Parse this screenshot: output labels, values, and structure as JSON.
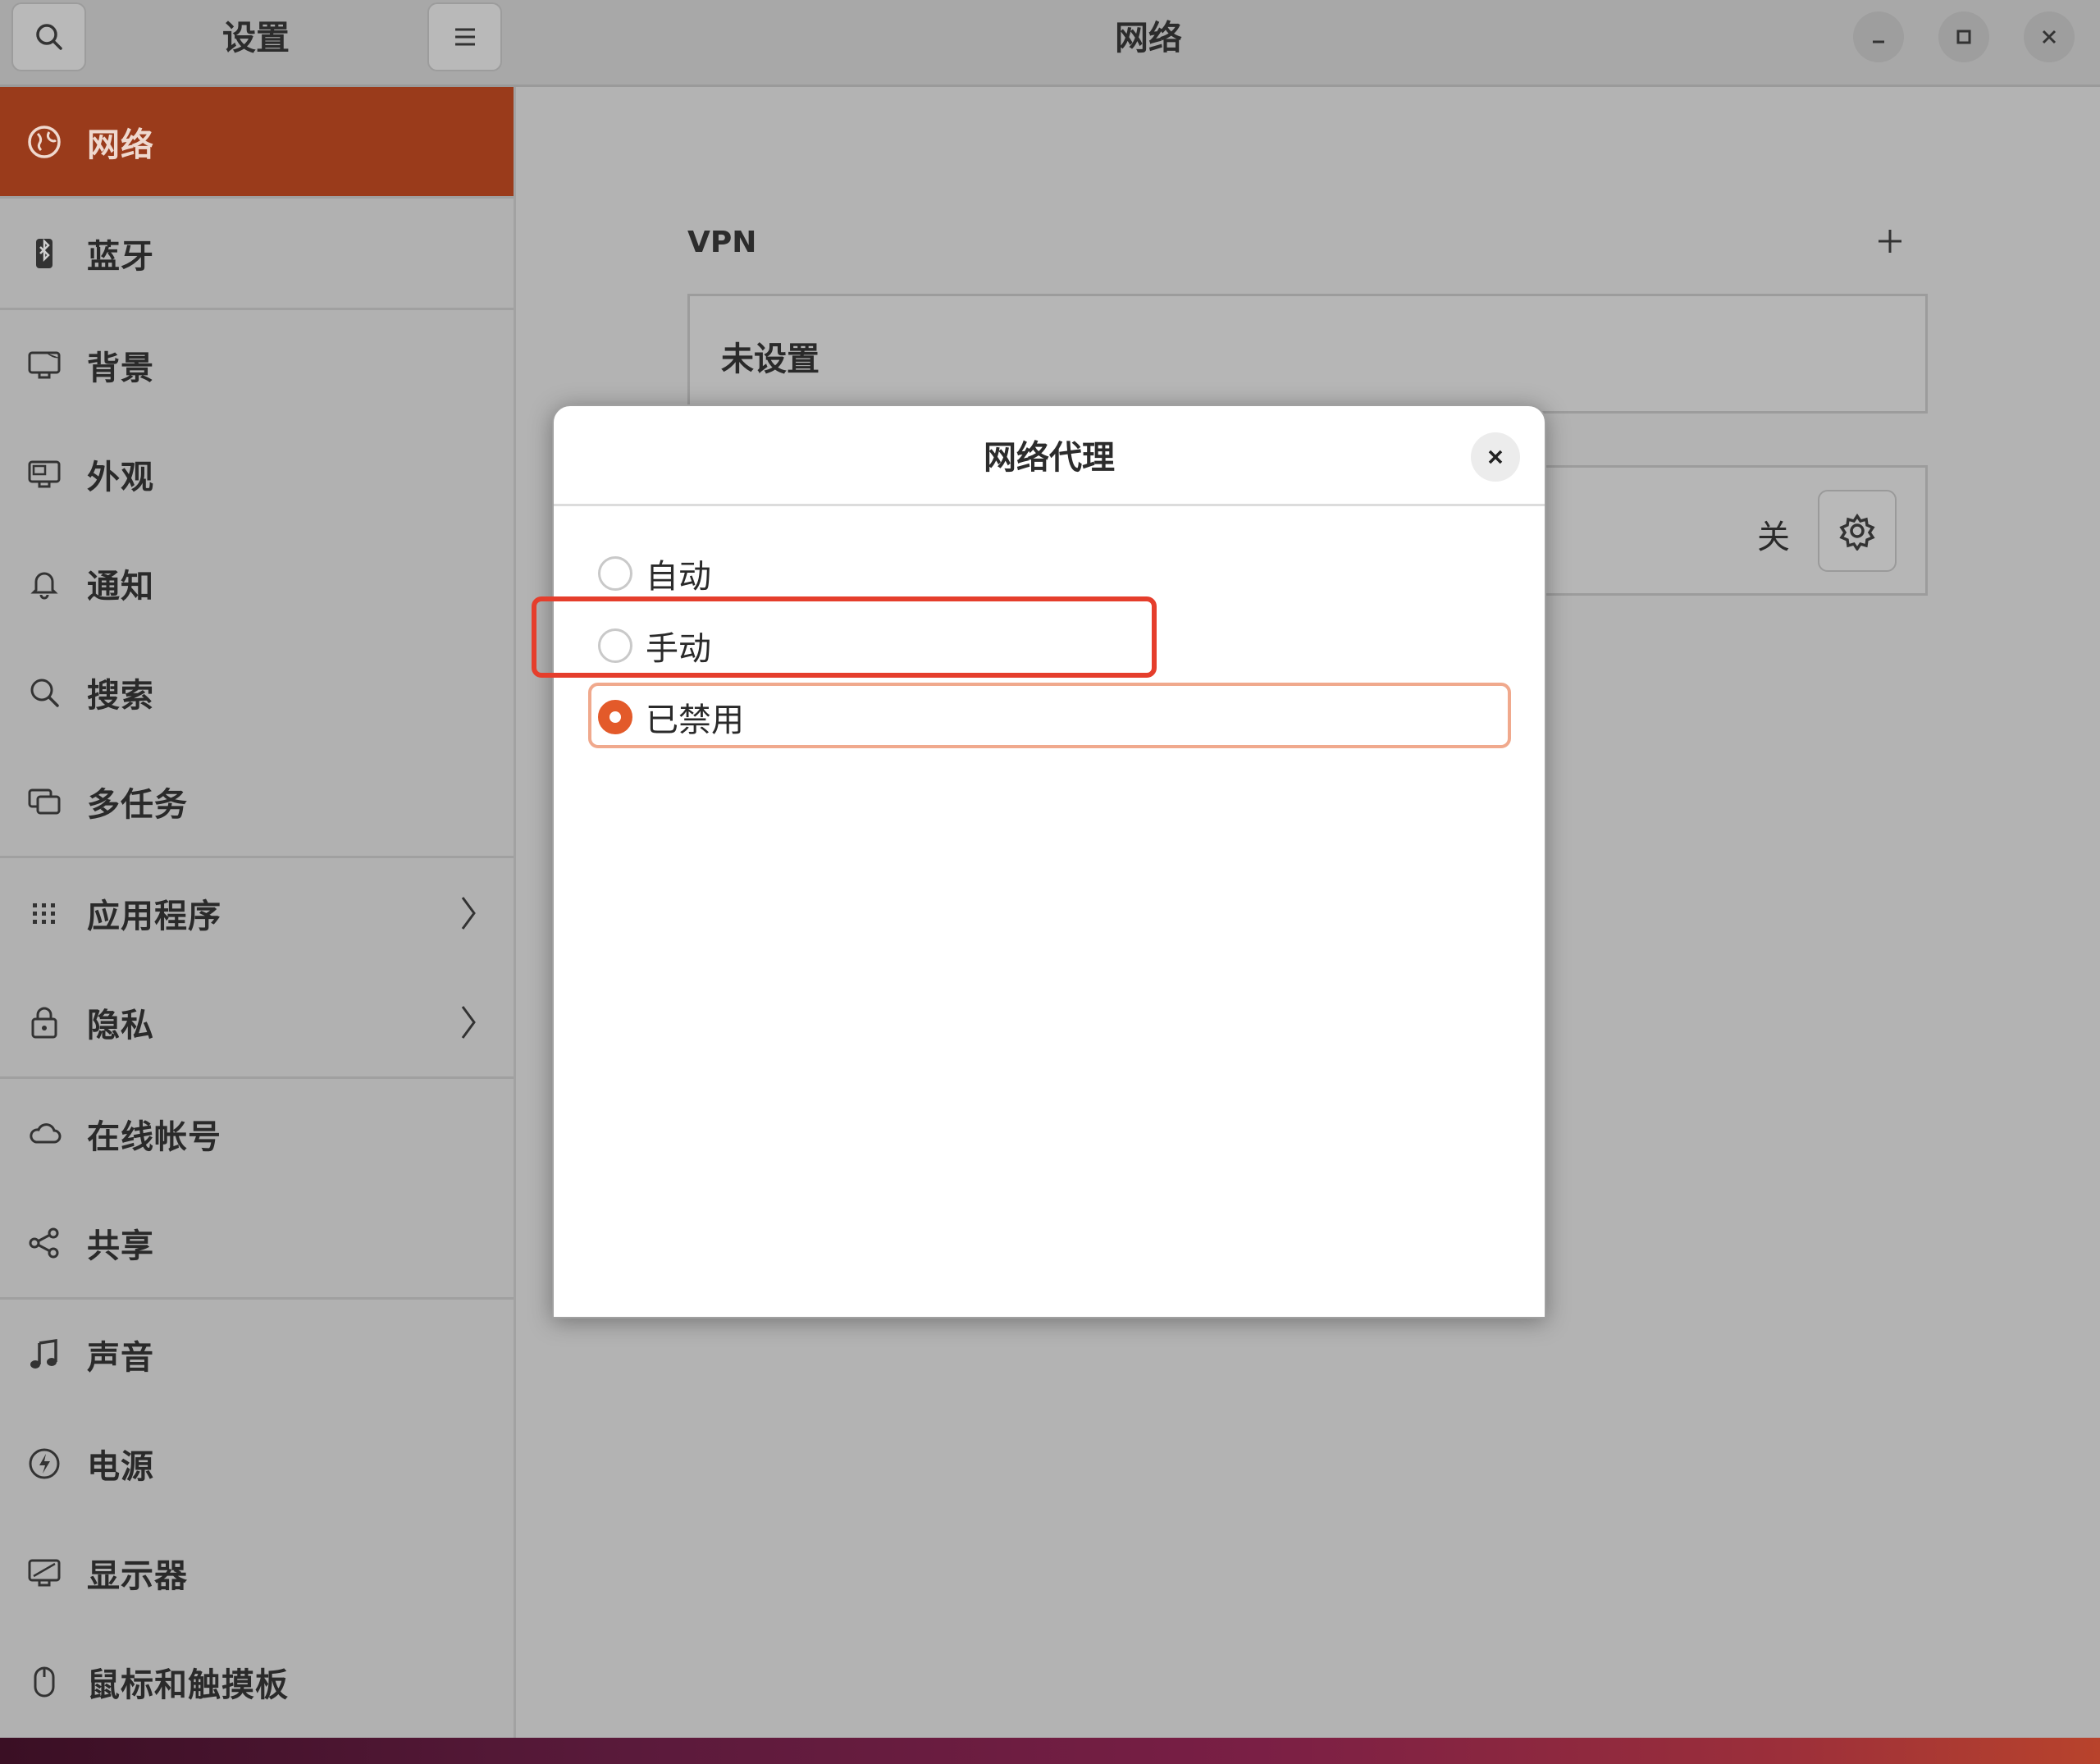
{
  "sidebar": {
    "title": "设置",
    "items": [
      {
        "label": "网络",
        "icon": "globe-icon"
      },
      {
        "label": "蓝牙",
        "icon": "bluetooth-icon"
      },
      {
        "label": "背景",
        "icon": "background-icon"
      },
      {
        "label": "外观",
        "icon": "appearance-icon"
      },
      {
        "label": "通知",
        "icon": "bell-icon"
      },
      {
        "label": "搜索",
        "icon": "search-icon"
      },
      {
        "label": "多任务",
        "icon": "multitask-icon"
      },
      {
        "label": "应用程序",
        "icon": "apps-grid-icon"
      },
      {
        "label": "隐私",
        "icon": "lock-icon"
      },
      {
        "label": "在线帐号",
        "icon": "cloud-icon"
      },
      {
        "label": "共享",
        "icon": "share-icon"
      },
      {
        "label": "声音",
        "icon": "music-note-icon"
      },
      {
        "label": "电源",
        "icon": "power-icon"
      },
      {
        "label": "显示器",
        "icon": "display-icon"
      },
      {
        "label": "鼠标和触摸板",
        "icon": "mouse-icon"
      }
    ]
  },
  "main": {
    "title": "网络",
    "vpn": {
      "section_title": "VPN",
      "empty_label": "未设置"
    },
    "proxy": {
      "state": "关"
    }
  },
  "dialog": {
    "title": "网络代理",
    "options": [
      {
        "label": "自动",
        "checked": false
      },
      {
        "label": "手动",
        "checked": false
      },
      {
        "label": "已禁用",
        "checked": true
      }
    ]
  },
  "colors": {
    "accent": "#e35a2a",
    "sidebar_active": "#9a3b1b",
    "highlight": "#e53e2c"
  }
}
